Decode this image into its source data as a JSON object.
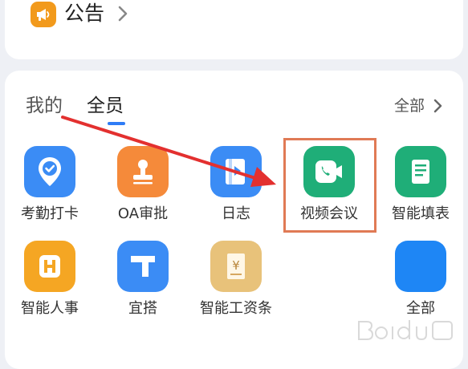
{
  "notice": {
    "title": "公告",
    "icon": "megaphone-icon"
  },
  "tabs": [
    {
      "label": "我的",
      "active": false
    },
    {
      "label": "全员",
      "active": true
    }
  ],
  "view_all_label": "全部",
  "apps": [
    {
      "label": "考勤打卡",
      "icon": "location-check-icon",
      "color": "#3b8cf5"
    },
    {
      "label": "OA审批",
      "icon": "stamp-icon",
      "color": "#f58a3a"
    },
    {
      "label": "日志",
      "icon": "journal-icon",
      "color": "#3b8cf5"
    },
    {
      "label": "视频会议",
      "icon": "video-call-icon",
      "color": "#1fae78"
    },
    {
      "label": "智能填表",
      "icon": "form-scroll-icon",
      "color": "#1fae78"
    },
    {
      "label": "智能人事",
      "icon": "hr-icon",
      "color": "#f5a623"
    },
    {
      "label": "宜搭",
      "icon": "yida-logo-icon",
      "color": "#3b8cf5"
    },
    {
      "label": "智能工资条",
      "icon": "payslip-icon",
      "color": "#e8c27a"
    },
    {
      "label": "全部",
      "icon": "all-apps-icon",
      "color": "#1e86f5"
    }
  ],
  "colors": {
    "accent": "#2f7cf6",
    "annotation": "#e3302f",
    "highlight": "#e07a55"
  }
}
